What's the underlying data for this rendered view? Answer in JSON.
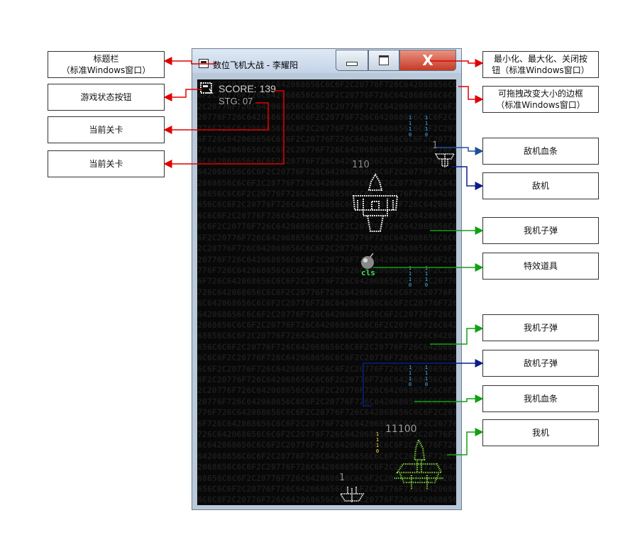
{
  "window": {
    "title": "数位飞机大战 - 李耀阳",
    "controls": {
      "close_glyph": "X"
    }
  },
  "game": {
    "status_button_icon": "game-status-icon",
    "score_text": "SCORE: 139",
    "stage_text": "STG: 07",
    "background_rows": [
      "6C6F2C20776F726C642068656C6C6F2C20776F726C642068656C6C",
      "6F2C20776F726C642068656C6C6F2C20776F726C642068656C6C6F",
      "2C20776F726C642068656C6C6F2C20776F726C642068656C6C6F2C",
      "20776F726C642068656C6C6F2C20776F726C642068656C6C6F2C20",
      "776F726C642068656C6C6F2C20776F726C642068656C6C6F2C2077",
      "6F726C642068656C6C6F2C20776F726C642068656C6C6F2C20776F",
      "726C642068656C6C6F2C20776F726C642068656C6C6F2C20776F72",
      "6C642068656C6C6F2C20776F726C642068656C6C6F2C20776F726C",
      "642068656C6C6F2C20776F726C642068656C6C6F2C20776F726C64",
      "2068656C6C6F2C20776F726C642068656C6C6F2C20776F726C6420",
      "68656C6C6F2C20776F726C642068656C6C6F2C20776F726C642068",
      "656C6C6F2C20776F726C642068656C6C6F2C20776F726C64206865",
      "6C6C6F2C20776F726C642068656C6C6F2C20776F726C642068656C",
      "6C6F2C20776F726C642068656C6C6F2C20776F726C642068656C6C",
      "6F2C20776F726C642068656C6C6F2C20776F726C642068656C6C6F",
      "2C20776F726C642068656C6C6F2C20776F726C642068656C6C6F2C",
      "20776F726C642068656C6C6F2C20776F726C642068656C6C6F2C20",
      "776F726C642068656C6C6F2C20776F726C642068656C6C6F2C2077",
      "6F726C642068656C6C6F2C20776F726C642068656C6C6F2C20776F",
      "726C642068656C6C6F2C20776F726C642068656C6C6F2C20776F72",
      "6C642068656C6C6F2C20776F726C642068656C6C6F2C20776F726C",
      "642068656C6C6F2C20776F726C642068656C6C6F2C20776F726C64",
      "2068656C6C6F2C20776F726C642068656C6C6F2C20776F726C6420",
      "68656C6C6F2C20776F726C642068656C6C6F2C20776F726C642068",
      "656C6C6F2C20776F726C642068656C6C6F2C20776F726C64206865",
      "6C6C6F2C20776F726C642068656C6C6F2C20776F726C642068656C",
      "6C6F2C20776F726C642068656C6C6F2C20776F726C642068656C6C",
      "6F2C20776F726C642068656C6C6F2C20776F726C642068656C6C6F",
      "2C20776F726C642068656C6C6F2C20776F726C642068656C6C6F2C",
      "20776F726C642068656C6C6F2C20776F726C642068656C6C6F2C20",
      "776F726C642068656C6C6F2C20776F726C642068656C6C6F2C2077",
      "6F726C642068656C6C6F2C20776F726C642068656C6C6F2C20776F",
      "726C642068656C6C6F2C20776F726C642068656C6C6F2C20776F72",
      "6C642068656C6C6F2C20776F726C642068656C6C6F2C20776F726C",
      "642068656C6C6F2C20776F726C642068656C6C6F2C20776F726C64",
      "2068656C6C6F2C20776F726C642068656C6C6F2C20776F726C6420",
      "68656C6C6F2C20776F726C642068656C6C6F2C20776F726C642068",
      "656C6C6F2C20776F726C642068656C6C6F2C20776F726C64206865",
      "6C6C6F2C20776F726C642068656C6C6F2C20776F726C642068656C"
    ],
    "enemy_small_hp": "1",
    "enemy_large_hp": "110",
    "enemy_bottom_hp": "1",
    "player_hp": "11100",
    "powerup_label": "cls",
    "bullet_text": "1110",
    "enemy_bullet_text": "1110",
    "player_glyph_text": "1 1 1 1 1 1 1 1 1 1 1 1 1 1 1 1 1 1 1 1 1 1 1 1 1 1 1 1 1 1 1 1 1 1 1 1 1 1 1 1 1 1 1 1 1 1 1 1",
    "colors": {
      "background": "#080808",
      "score": "#c8c8c8",
      "bullet": "#45b4ff",
      "enemy_bullet": "#ffe24a",
      "player": "#9cff4a",
      "powerup_label": "#3de05a"
    }
  },
  "annotations": {
    "title_bar": [
      "标题栏",
      "（标准Windows窗口）"
    ],
    "status_button": "游戏状态按钮",
    "current_stage_1": "当前关卡",
    "current_stage_2": "当前关卡",
    "window_buttons": [
      "最小化、最大化、关闭按",
      "钮（标准Windows窗口）"
    ],
    "resizable_border": [
      "可拖拽改变大小的边框",
      "（标准Windows窗口）"
    ],
    "enemy_hp_bar": "敌机血条",
    "enemy": "敌机",
    "player_bullet_1": "我机子弹",
    "powerup": "特效道具",
    "player_bullet_2": "我机子弹",
    "enemy_bullet": "敌机子弹",
    "player_hp_bar": "我机血条",
    "player": "我机"
  }
}
